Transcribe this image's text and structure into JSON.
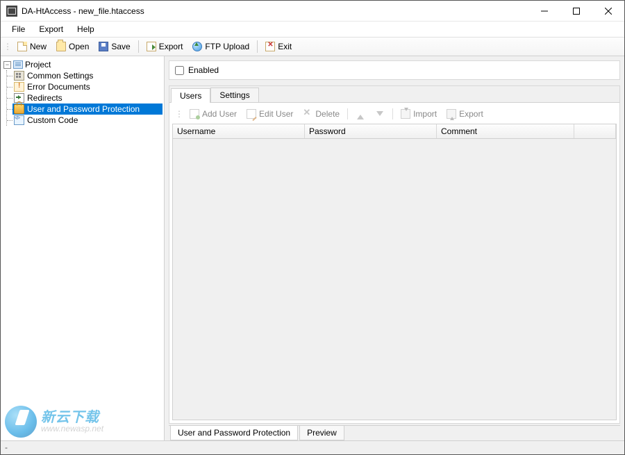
{
  "window": {
    "title": "DA-HtAccess - new_file.htaccess"
  },
  "menubar": {
    "file": "File",
    "export": "Export",
    "help": "Help"
  },
  "toolbar": {
    "new": "New",
    "open": "Open",
    "save": "Save",
    "export": "Export",
    "ftp": "FTP Upload",
    "exit": "Exit"
  },
  "tree": {
    "root": "Project",
    "items": [
      "Common Settings",
      "Error Documents",
      "Redirects",
      "User and Password Protection",
      "Custom Code"
    ]
  },
  "main": {
    "enabled_label": "Enabled",
    "enabled_checked": false,
    "tabs": {
      "users": "Users",
      "settings": "Settings"
    },
    "usertoolbar": {
      "add": "Add User",
      "edit": "Edit User",
      "delete": "Delete",
      "import": "Import",
      "export": "Export"
    },
    "columns": {
      "username": "Username",
      "password": "Password",
      "comment": "Comment"
    }
  },
  "bottom_tabs": {
    "protection": "User and Password Protection",
    "preview": "Preview"
  },
  "statusbar": {
    "text": "-"
  },
  "watermark": {
    "cn": "新云下载",
    "url": "www.newasp.net"
  }
}
